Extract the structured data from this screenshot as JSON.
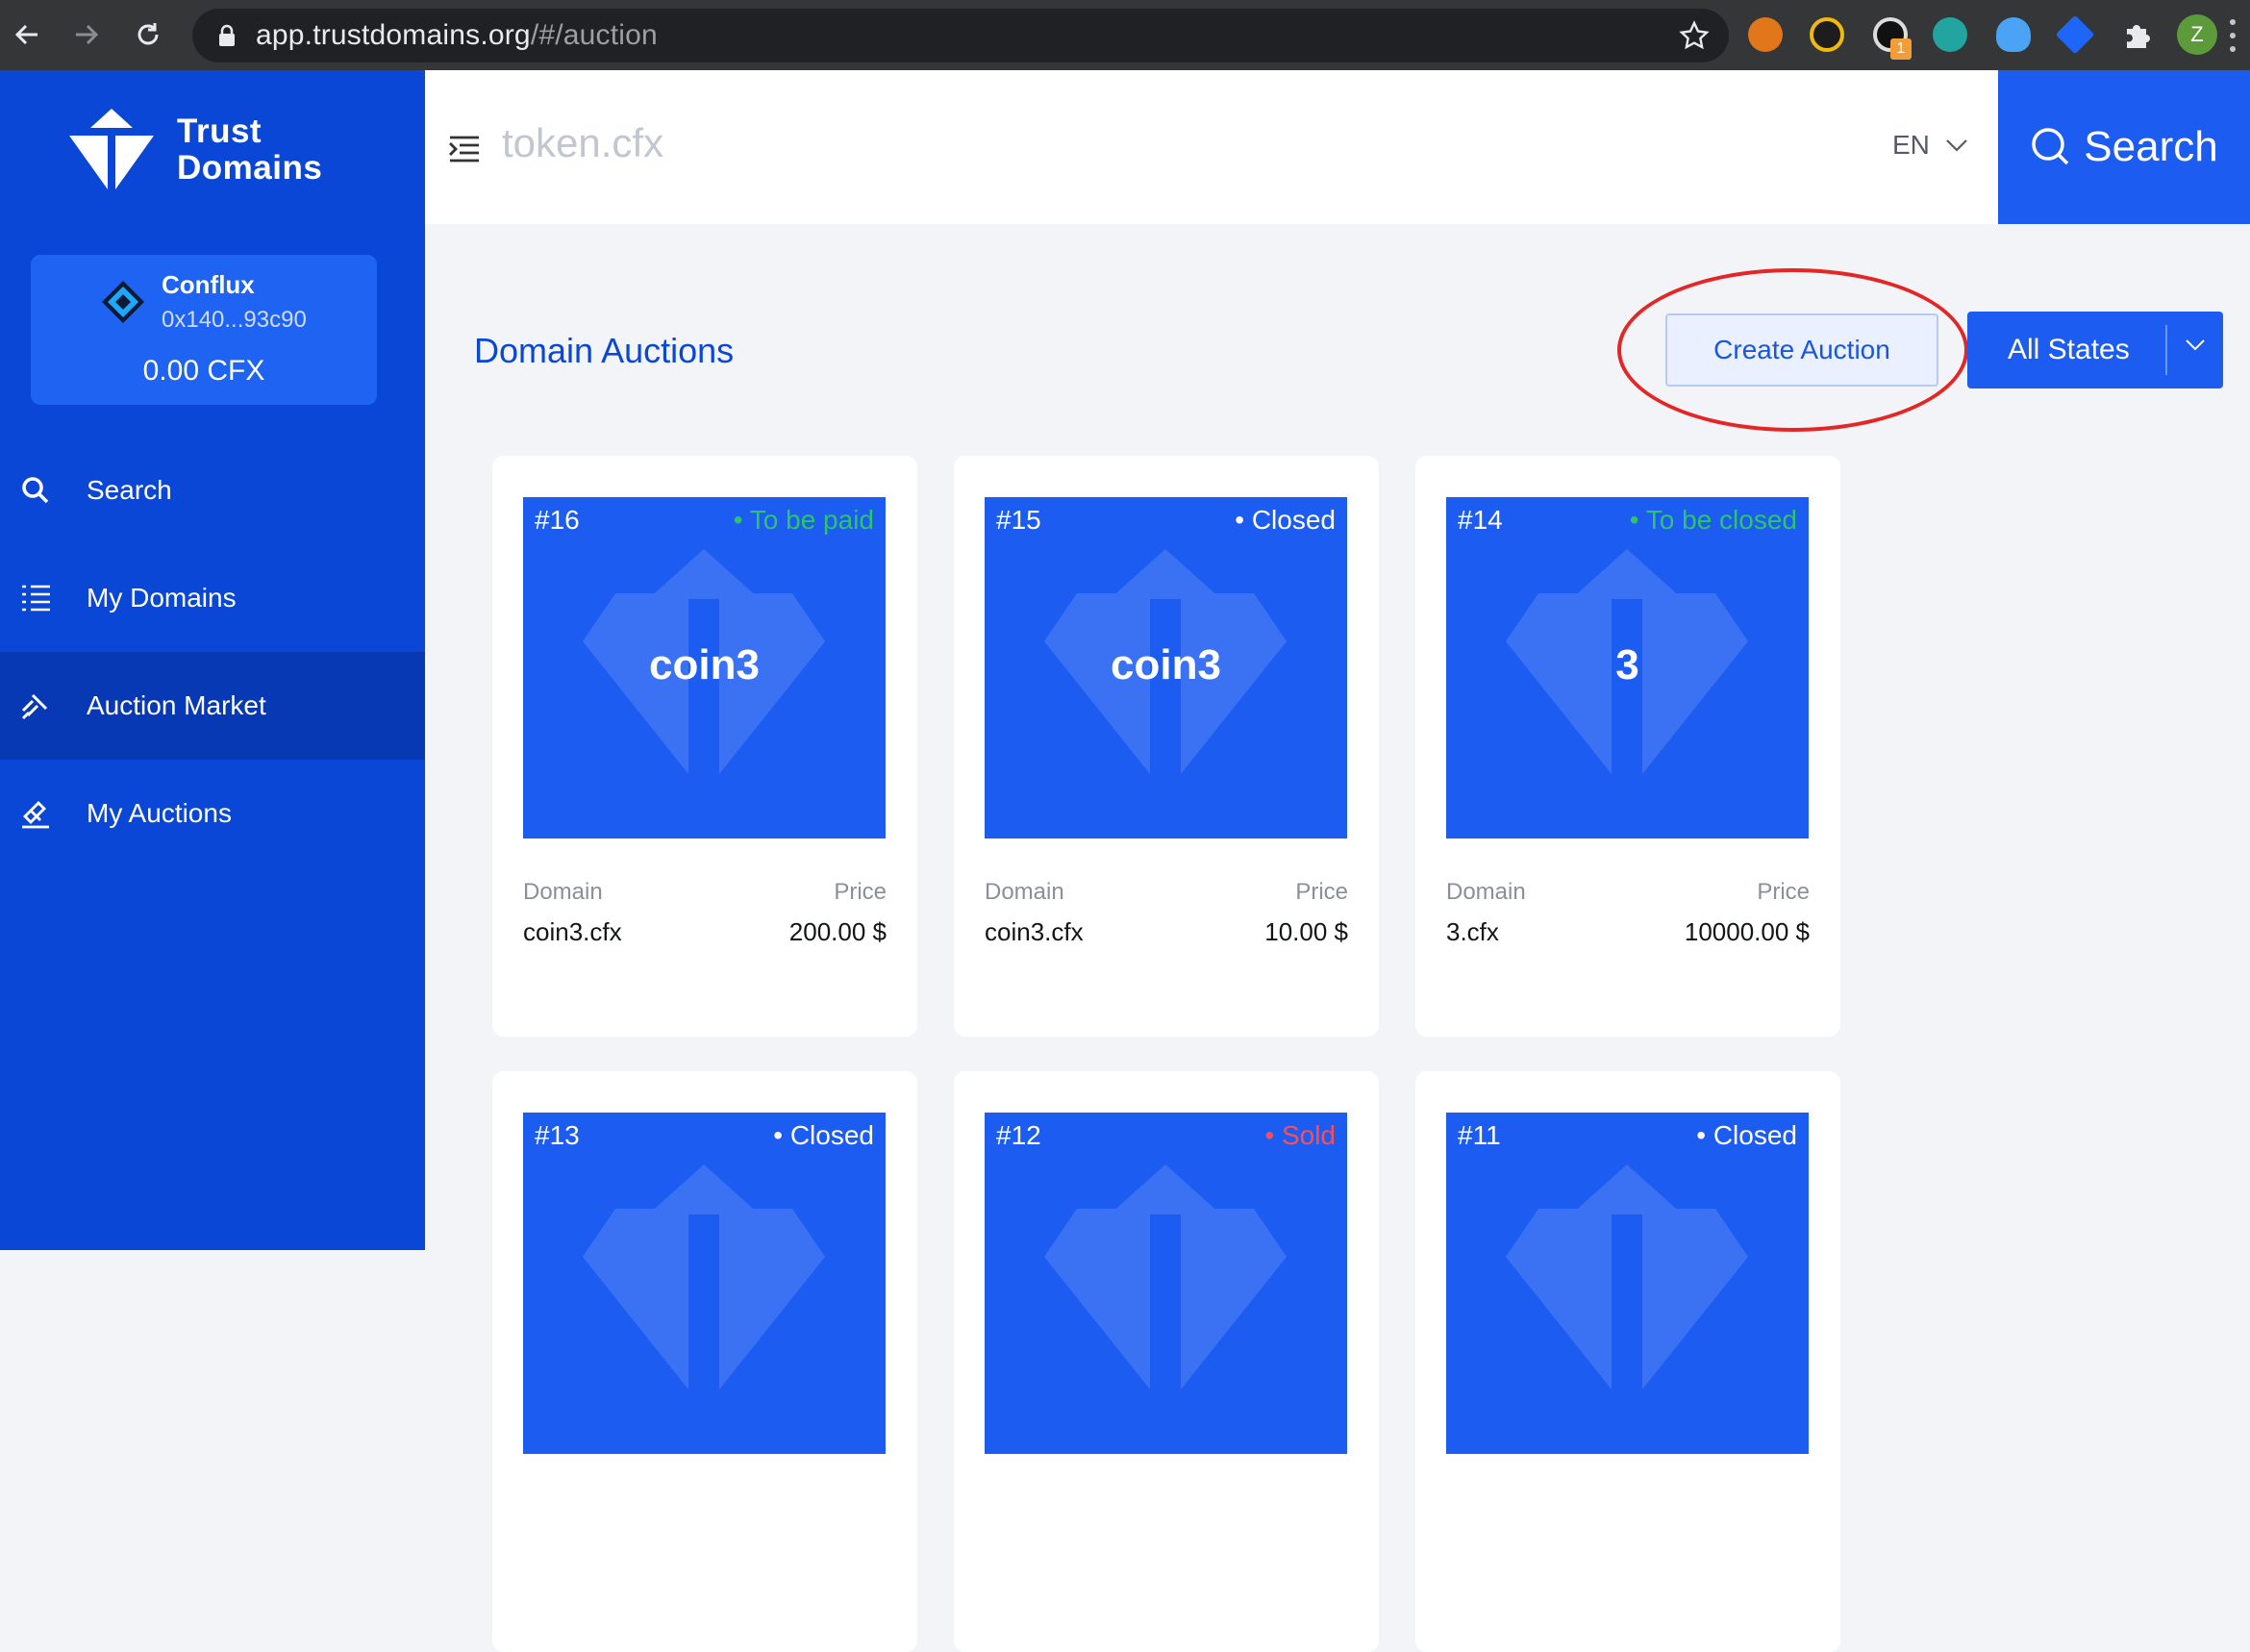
{
  "browser": {
    "url_host": "app.trustdomains.org",
    "url_path": "/#/auction",
    "profile_initial": "Z",
    "extension_badge": "1"
  },
  "sidebar": {
    "brand_line1": "Trust",
    "brand_line2": "Domains",
    "wallet": {
      "chain": "Conflux",
      "address": "0x140...93c90",
      "balance": "0.00 CFX"
    },
    "items": [
      {
        "label": "Search",
        "icon": "search-icon"
      },
      {
        "label": "My Domains",
        "icon": "list-icon"
      },
      {
        "label": "Auction Market",
        "icon": "gavel-icon",
        "active": true
      },
      {
        "label": "My Auctions",
        "icon": "hammer-icon"
      }
    ]
  },
  "header": {
    "query": "token.cfx",
    "language": "EN",
    "search_label": "Search"
  },
  "main": {
    "title": "Domain Auctions",
    "create_label": "Create Auction",
    "filter_label": "All States",
    "domain_label": "Domain",
    "price_label": "Price",
    "cards": [
      {
        "id": "#16",
        "state": "• To be paid",
        "state_color": "#2ec46b",
        "name": "coin3",
        "domain": "coin3.cfx",
        "price": "200.00 $"
      },
      {
        "id": "#15",
        "state": "• Closed",
        "state_color": "#ffffff",
        "name": "coin3",
        "domain": "coin3.cfx",
        "price": "10.00 $"
      },
      {
        "id": "#14",
        "state": "• To be closed",
        "state_color": "#2ec46b",
        "name": "3",
        "domain": "3.cfx",
        "price": "10000.00 $"
      },
      {
        "id": "#13",
        "state": "• Closed",
        "state_color": "#ffffff"
      },
      {
        "id": "#12",
        "state": "• Sold",
        "state_color": "#ff4d4f"
      },
      {
        "id": "#11",
        "state": "• Closed",
        "state_color": "#ffffff"
      }
    ]
  },
  "colors": {
    "primary": "#1c5cf0",
    "sidebar": "#0a47d6",
    "annotation_ring": "#e32626"
  }
}
